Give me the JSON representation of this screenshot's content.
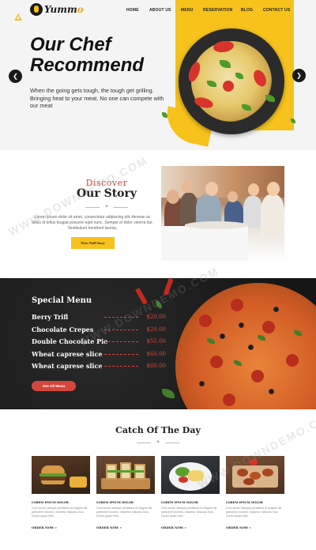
{
  "brand": {
    "name_main": "Yumm",
    "name_accent": "o"
  },
  "nav": {
    "items": [
      "HOME",
      "ABOUT US",
      "MENU",
      "RESERVATION",
      "BLOG",
      "CONTACT US"
    ]
  },
  "hero": {
    "title_line1": "Our Chef",
    "title_line2": "Recommend",
    "text": "When the going gets tough, the tough get grilling. Bringing heat to your meat. No one can compete with our meat",
    "prev_icon": "chevron-left-icon",
    "next_icon": "chevron-right-icon",
    "accent_color": "#f6c21b"
  },
  "story": {
    "eyebrow": "Discover",
    "title": "Our Story",
    "text": "Lorem ipsum dolor sit amet, consectetur adipiscing elit. Aenean ac tellus id tellus feugiat posuere eget nunc. Semper et dolor viverra dui. Vestibulum hendrerit lacinia.",
    "button": "View Full Story"
  },
  "special": {
    "title": "Special Menu",
    "items": [
      {
        "name": "Berry Trifl",
        "price": "$20.00"
      },
      {
        "name": "Chocolate Crepes",
        "price": "$20.00"
      },
      {
        "name": "Double Chocolate Pie",
        "price": "$55.00"
      },
      {
        "name": "Wheat caprese slice",
        "price": "$60.00"
      },
      {
        "name": "Wheat caprese slice",
        "price": "$60.00"
      }
    ],
    "button": "See All Menu",
    "price_color": "#d4463d"
  },
  "catch": {
    "title": "Catch Of The Day",
    "cards": [
      {
        "title": "LOREM IPSUM DOLOR",
        "text": "Cum sociis natoque penatibus et magnis dis parturient montes, nascetur ridiculus mus. Donec quam felis.",
        "link": "ORDER NOW »"
      },
      {
        "title": "LOREM IPSUM DOLOR",
        "text": "Cum sociis natoque penatibus et magnis dis parturient montes, nascetur ridiculus mus. Donec quam felis.",
        "link": "ORDER NOW »"
      },
      {
        "title": "LOREM IPSUM DOLOR",
        "text": "Cum sociis natoque penatibus et magnis dis parturient montes, nascetur ridiculus mus. Donec quam felis.",
        "link": "ORDER NOW »"
      },
      {
        "title": "LOREM IPSUM DOLOR",
        "text": "Cum sociis natoque penatibus et magnis dis parturient montes, nascetur ridiculus mus. Donec quam felis.",
        "link": "ORDER NOW »"
      }
    ]
  },
  "watermark": "WWW.DOWNDEMO.COM"
}
